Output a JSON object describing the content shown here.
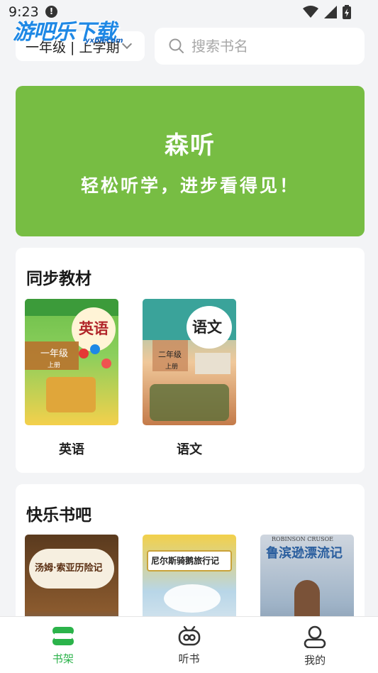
{
  "status_bar": {
    "time": "9:23"
  },
  "watermark": {
    "text": "游吧乐下载",
    "sub": "yxblecom"
  },
  "header": {
    "grade_select": {
      "value": "一年级 | 上学期"
    },
    "search": {
      "placeholder": "搜索书名"
    }
  },
  "banner": {
    "title": "森听",
    "slogan": "轻松听学，进步看得见！"
  },
  "sync_section": {
    "title": "同步教材",
    "books": [
      {
        "label": "英语",
        "cover_title": "英语",
        "cover_grade": "一年级",
        "cover_term": "上册"
      },
      {
        "label": "语文",
        "cover_title": "语文",
        "cover_grade": "二年级",
        "cover_term": "上册"
      }
    ]
  },
  "happy_section": {
    "title": "快乐书吧",
    "books": [
      {
        "cover_title": "汤姆·索亚历险记"
      },
      {
        "cover_title": "尼尔斯骑鹅旅行记"
      },
      {
        "cover_title": "鲁滨逊漂流记",
        "cover_top": "ROBINSON CRUSOE"
      }
    ]
  },
  "bottom_nav": {
    "items": [
      {
        "label": "书架",
        "active": true
      },
      {
        "label": "听书",
        "active": false
      },
      {
        "label": "我的",
        "active": false
      }
    ]
  },
  "colors": {
    "accent": "#2bb34a",
    "banner": "#77bd43"
  }
}
